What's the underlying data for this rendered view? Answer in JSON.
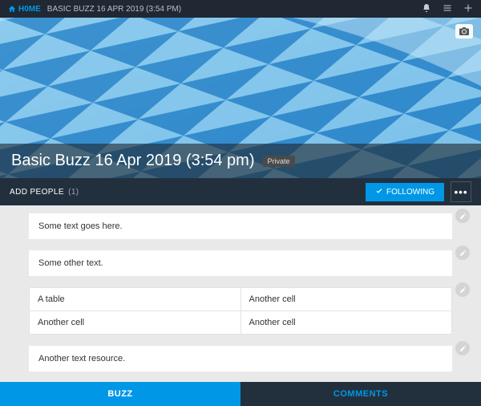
{
  "nav": {
    "home": "H0ME",
    "breadcrumb": "BASIC BUZZ 16 APR 2019 (3:54 PM)"
  },
  "page": {
    "title": "Basic Buzz 16 Apr 2019 (3:54 pm)",
    "privacy": "Private"
  },
  "actions": {
    "add_people": "ADD PEOPLE",
    "add_people_count": "(1)",
    "following": "FOLLOWING",
    "more": "•••"
  },
  "resources": [
    {
      "type": "text",
      "text": "Some text goes here."
    },
    {
      "type": "text",
      "text": "Some other text."
    },
    {
      "type": "table",
      "rows": [
        [
          "A table",
          "Another cell"
        ],
        [
          "Another cell",
          "Another cell"
        ]
      ]
    },
    {
      "type": "text",
      "text": "Another text resource."
    }
  ],
  "tabs": {
    "buzz": "BUZZ",
    "comments": "COMMENTS"
  }
}
